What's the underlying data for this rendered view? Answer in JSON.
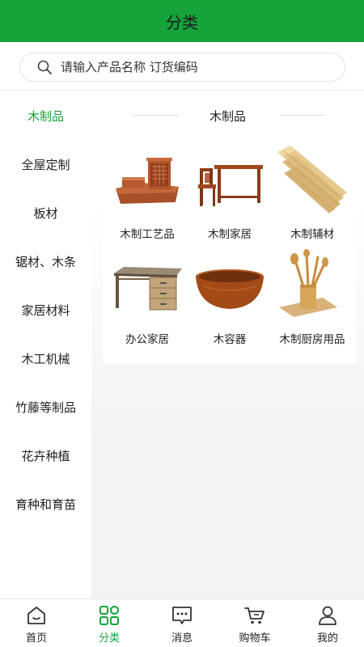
{
  "header": {
    "title": "分类"
  },
  "search": {
    "placeholder": "请输入产品名称 订货编码"
  },
  "sidebar": {
    "items": [
      {
        "label": "木制品",
        "active": true
      },
      {
        "label": "全屋定制"
      },
      {
        "label": "板材"
      },
      {
        "label": "锯材、木条"
      },
      {
        "label": "家居材料"
      },
      {
        "label": "木工机械"
      },
      {
        "label": "竹藤等制品"
      },
      {
        "label": "花卉种植"
      },
      {
        "label": "育种和育苗"
      }
    ]
  },
  "main": {
    "section_title": "木制品",
    "products": [
      {
        "label": "木制工艺品",
        "icon": "wood-craft-image"
      },
      {
        "label": "木制家居",
        "icon": "wood-furniture-image"
      },
      {
        "label": "木制辅材",
        "icon": "wood-planks-image"
      },
      {
        "label": "办公家居",
        "icon": "office-desk-image"
      },
      {
        "label": "木容器",
        "icon": "wood-bowl-image"
      },
      {
        "label": "木制厨房用品",
        "icon": "kitchen-utensils-image"
      }
    ]
  },
  "tabbar": {
    "items": [
      {
        "label": "首页",
        "icon": "home-icon"
      },
      {
        "label": "分类",
        "icon": "category-icon",
        "active": true
      },
      {
        "label": "消息",
        "icon": "message-icon"
      },
      {
        "label": "购物车",
        "icon": "cart-icon"
      },
      {
        "label": "我的",
        "icon": "user-icon"
      }
    ]
  },
  "colors": {
    "accent": "#15a33a",
    "text": "#222222",
    "divider": "#eeeeee"
  }
}
